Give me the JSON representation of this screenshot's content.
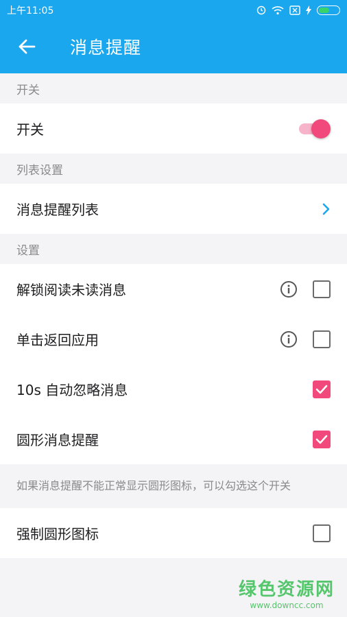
{
  "status": {
    "time": "上午11:05"
  },
  "appbar": {
    "title": "消息提醒"
  },
  "sections": {
    "switch": {
      "header": "开关",
      "row_label": "开关",
      "enabled": true
    },
    "list": {
      "header": "列表设置",
      "row_label": "消息提醒列表"
    },
    "settings": {
      "header": "设置",
      "items": [
        {
          "label": "解锁阅读未读消息",
          "checked": false,
          "info_icon": "info-icon"
        },
        {
          "label": "单击返回应用",
          "checked": false,
          "info_icon": "info-icon"
        },
        {
          "label": "10s 自动忽略消息",
          "checked": true
        },
        {
          "label": "圆形消息提醒",
          "checked": true
        }
      ]
    },
    "force": {
      "note": "如果消息提醒不能正常显示圆形图标，可以勾选这个开关",
      "row_label": "强制圆形图标",
      "checked": false
    }
  },
  "watermark": {
    "title": "绿色资源网",
    "url": "www.downcc.com"
  },
  "colors": {
    "primary": "#1aa7ee",
    "accent": "#f2497c"
  },
  "battery_level": 0.55
}
